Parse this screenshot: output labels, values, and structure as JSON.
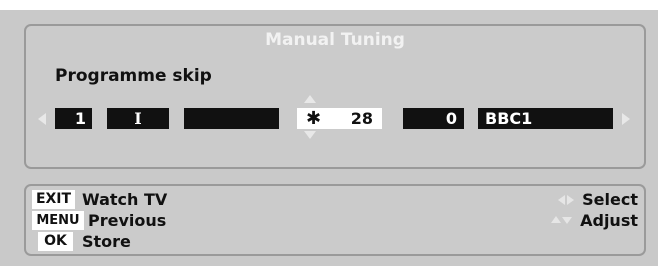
{
  "menu": {
    "title": "Manual Tuning",
    "subtitle": "Programme skip"
  },
  "tuning_row": {
    "programme_number": "1",
    "system": "I",
    "skip_field": "",
    "skip_marker": "✱",
    "channel": "28",
    "fine_tune": "0",
    "station_name": "BBC1"
  },
  "footer": {
    "exit_key": "EXIT",
    "exit_label": "Watch TV",
    "menu_key": "MENU",
    "menu_label": "Previous",
    "ok_key": "OK",
    "ok_label": "Store",
    "select_label": "Select",
    "adjust_label": "Adjust"
  },
  "icons": {
    "row_left": "triangle-left",
    "row_right": "triangle-right",
    "value_up": "triangle-up",
    "value_down": "triangle-down",
    "select_hint": "left-right-arrows",
    "adjust_hint": "up-down-arrows"
  },
  "colors": {
    "panel": "#cbcbcb",
    "field": "#111111",
    "highlight_field": "#ffffff",
    "title_text": "#f2f2f2"
  }
}
